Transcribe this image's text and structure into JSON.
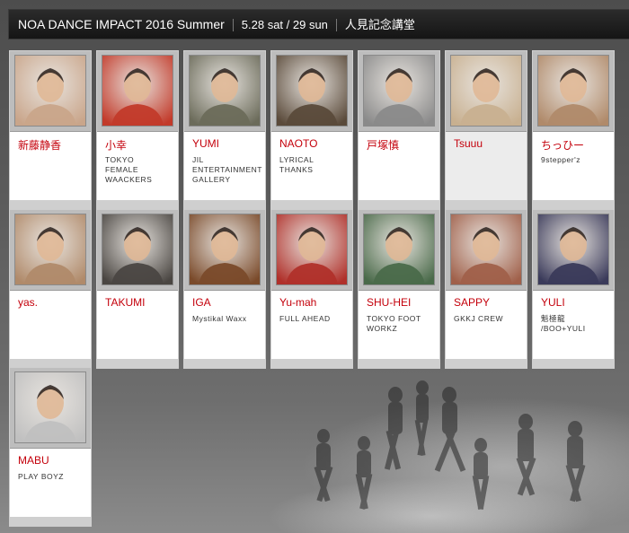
{
  "header": {
    "title": "NOA DANCE IMPACT 2016 Summer",
    "dates": "5.28 sat / 29 sun",
    "venue": "人見記念講堂"
  },
  "dancers": [
    {
      "name": "新藤静香",
      "team": "",
      "photo_tone": "#c9a58a"
    },
    {
      "name": "小幸",
      "team": "TOKYO\nFEMALE\nWAACKERS",
      "photo_tone": "#c23a2a"
    },
    {
      "name": "YUMI",
      "team": "JIL\nENTERTAINMENT\nGALLERY",
      "photo_tone": "#6b6b5a"
    },
    {
      "name": "NAOTO",
      "team": "LYRICAL\nTHANKS",
      "photo_tone": "#5a4a3a"
    },
    {
      "name": "戸塚慎",
      "team": "",
      "photo_tone": "#8a8a8a"
    },
    {
      "name": "Tsuuu",
      "team": "",
      "photo_tone": "#c8b090"
    },
    {
      "name": "ちっひー",
      "team": "9stepper'z",
      "photo_tone": "#b08a6a"
    },
    {
      "name": "yas.",
      "team": "",
      "photo_tone": "#b08a6a"
    },
    {
      "name": "TAKUMI",
      "team": "",
      "photo_tone": "#4a4642"
    },
    {
      "name": "IGA",
      "team": "Mystikal Waxx",
      "photo_tone": "#7a4a2a"
    },
    {
      "name": "Yu-mah",
      "team": "FULL AHEAD",
      "photo_tone": "#b0302a"
    },
    {
      "name": "SHU-HEI",
      "team": "TOKYO FOOT\nWORKZ",
      "photo_tone": "#4a6a4a"
    },
    {
      "name": "SAPPY",
      "team": "GKKJ CREW",
      "photo_tone": "#a0604a"
    },
    {
      "name": "YULI",
      "team": "魁極龍\n/BOO+YULI",
      "photo_tone": "#3a3a5a"
    },
    {
      "name": "MABU",
      "team": "PLAY BOYZ",
      "photo_tone": "#c0c0c0"
    }
  ],
  "colors": {
    "name_red": "#c4000b",
    "header_bg": "#1c1c1c"
  }
}
